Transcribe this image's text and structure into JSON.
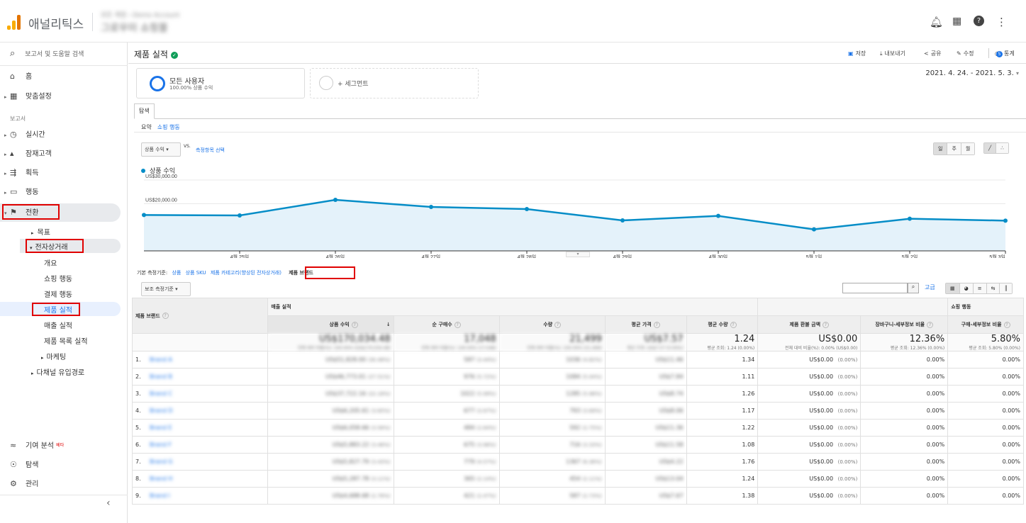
{
  "topbar": {
    "app_name": "애널리틱스",
    "account_line1": "모든 계정 › Demo Account",
    "account_line2": "그로우미 쇼핑몰",
    "bell_icon": "bell-icon",
    "apps_icon": "apps-grid-icon",
    "help_icon": "help-icon",
    "more_icon": "more-vert-icon"
  },
  "sidebar": {
    "search_label": "보고서 및 도움말 검색",
    "home": "홈",
    "custom": "맞춤설정",
    "reports_header": "보고서",
    "realtime": "실시간",
    "audience": "잠재고객",
    "acquisition": "획득",
    "behavior": "행동",
    "conversions": "전환",
    "goals": "목표",
    "ecommerce": "전자상거래",
    "overview": "개요",
    "shopping_behavior": "쇼핑 행동",
    "checkout_behavior": "결제 행동",
    "product_performance": "제품 실적",
    "sales_performance": "매출 실적",
    "product_list_performance": "제품 목록 실적",
    "marketing": "마케팅",
    "multichannel": "다채널 유입경로",
    "attribution": "기여 분석",
    "beta": "베타",
    "discover": "탐색",
    "admin": "관리",
    "collapse": "‹"
  },
  "header": {
    "title": "제품 실적",
    "save": "저장",
    "export": "내보내기",
    "share": "공유",
    "edit": "수정",
    "insights": "통계",
    "insights_count": "5"
  },
  "segments": {
    "all_users": "모든 사용자",
    "all_users_sub": "100.00% 상품 수익",
    "add_segment": "+ 세그먼트"
  },
  "date_range": "2021. 4. 24. - 2021. 5. 3.",
  "tabs": {
    "explore": "탐색",
    "summary": "요약",
    "shopping_behavior": "쇼핑 행동"
  },
  "graph_controls": {
    "metric": "상품 수익",
    "vs": "VS.",
    "select_metric": "측정항목 선택",
    "day": "일",
    "week": "주",
    "month": "월"
  },
  "chart_data": {
    "type": "line",
    "series": [
      {
        "name": "상품 수익",
        "values": [
          15200,
          15000,
          21600,
          18600,
          17700,
          12900,
          14800,
          9100,
          13600,
          12800
        ]
      }
    ],
    "x": [
      "...",
      "4월 25일",
      "4월 26일",
      "4월 27일",
      "4월 28일",
      "4월 29일",
      "4월 30일",
      "5월 1일",
      "5월 2일",
      "5월 3일"
    ],
    "yticks": [
      "US$30,000.00",
      "US$20,000.00",
      "US$10,000.00"
    ],
    "ylim": [
      0,
      30000
    ],
    "color": "#058dc7",
    "fill": "#e4f2fa"
  },
  "primary_dims": {
    "label": "기본 측정기준:",
    "items": [
      "상품",
      "상품 SKU",
      "제품 카테고리(향상된 전자상거래)"
    ],
    "selected": "제품 브랜드"
  },
  "table_controls": {
    "secondary": "보조 측정기준",
    "advanced": "고급"
  },
  "table": {
    "dim_header": "제품 브랜드",
    "group1": "매출 실적",
    "group2": "쇼핑 행동",
    "columns": [
      "상품 수익",
      "순 구매수",
      "수량",
      "평균 가격",
      "평균 수량",
      "제품 환불 금액",
      "장바구니-세부정보 비율",
      "구매-세부정보 비율"
    ],
    "sort_icon": "sort-down-icon",
    "totals": {
      "revenue": "US$170,034.48",
      "revenue_sub": "전체 대비 비율(%): 100.00% (US$170,034.48)",
      "purchases": "17,048",
      "purchases_sub": "전체 대비 비율(%): 100.00% (17,048)",
      "qty": "21,499",
      "qty_sub": "전체 대비 비율(%): 100.00% (21,499)",
      "avgprice": "US$7.57",
      "avgprice_sub": "평균 조회: US$7.57 (0.00%)",
      "avgqty": "1.24",
      "avgqty_sub": "평균 조회: 1.24 (0.00%)",
      "refund": "US$0.00",
      "refund_sub": "전체 대비 비율(%): 0.00% (US$0.00)",
      "cart": "12.36%",
      "cart_sub": "평균 조회: 12.36% (0.00%)",
      "buy": "5.80%",
      "buy_sub": "평균 조회: 5.80% (0.00%)"
    },
    "rows": [
      {
        "n": "1.",
        "brand": "Brand A",
        "rev": "US$51,828.00",
        "revp": "(30.48%)",
        "pur": "587",
        "purp": "(3.44%)",
        "qty": "1036",
        "qtyp": "(4.82%)",
        "avg": "US$11.46",
        "aq": "1.34",
        "ref": "US$0.00",
        "refp": "(0.00%)",
        "cart": "0.00%",
        "buy": "0.00%"
      },
      {
        "n": "2.",
        "brand": "Brand B",
        "rev": "US$46,773.01",
        "revp": "(27.51%)",
        "pur": "976",
        "purp": "(5.72%)",
        "qty": "1084",
        "qtyp": "(5.04%)",
        "avg": "US$7.84",
        "aq": "1.11",
        "ref": "US$0.00",
        "refp": "(0.00%)",
        "cart": "0.00%",
        "buy": "0.00%"
      },
      {
        "n": "3.",
        "brand": "Brand C",
        "rev": "US$37,722.16",
        "revp": "(22.18%)",
        "pur": "1022",
        "purp": "(5.99%)",
        "qty": "1285",
        "qtyp": "(5.98%)",
        "avg": "US$8.74",
        "aq": "1.26",
        "ref": "US$0.00",
        "refp": "(0.00%)",
        "cart": "0.00%",
        "buy": "0.00%"
      },
      {
        "n": "4.",
        "brand": "Brand D",
        "rev": "US$6,205.61",
        "revp": "(3.65%)",
        "pur": "677",
        "purp": "(3.97%)",
        "qty": "793",
        "qtyp": "(3.69%)",
        "avg": "US$8.06",
        "aq": "1.17",
        "ref": "US$0.00",
        "refp": "(0.00%)",
        "cart": "0.00%",
        "buy": "0.00%"
      },
      {
        "n": "5.",
        "brand": "Brand E",
        "rev": "US$6,058.66",
        "revp": "(3.56%)",
        "pur": "484",
        "purp": "(2.84%)",
        "qty": "592",
        "qtyp": "(2.75%)",
        "avg": "US$11.36",
        "aq": "1.22",
        "ref": "US$0.00",
        "refp": "(0.00%)",
        "cart": "0.00%",
        "buy": "0.00%"
      },
      {
        "n": "6.",
        "brand": "Brand F",
        "rev": "US$5,883.22",
        "revp": "(3.46%)",
        "pur": "675",
        "purp": "(3.96%)",
        "qty": "716",
        "qtyp": "(3.33%)",
        "avg": "US$11.58",
        "aq": "1.08",
        "ref": "US$0.00",
        "refp": "(0.00%)",
        "cart": "0.00%",
        "buy": "0.00%"
      },
      {
        "n": "7.",
        "brand": "Brand G",
        "rev": "US$5,827.79",
        "revp": "(3.43%)",
        "pur": "779",
        "purp": "(4.57%)",
        "qty": "1367",
        "qtyp": "(6.36%)",
        "avg": "US$4.22",
        "aq": "1.76",
        "ref": "US$0.00",
        "refp": "(0.00%)",
        "cart": "0.00%",
        "buy": "0.00%"
      },
      {
        "n": "8.",
        "brand": "Brand H",
        "rev": "US$5,287.78",
        "revp": "(3.11%)",
        "pur": "365",
        "purp": "(2.14%)",
        "qty": "454",
        "qtyp": "(2.11%)",
        "avg": "US$13.04",
        "aq": "1.24",
        "ref": "US$0.00",
        "refp": "(0.00%)",
        "cart": "0.00%",
        "buy": "0.00%"
      },
      {
        "n": "9.",
        "brand": "Brand I",
        "rev": "US$4,688.68",
        "revp": "(2.76%)",
        "pur": "421",
        "purp": "(2.47%)",
        "qty": "587",
        "qtyp": "(2.73%)",
        "avg": "US$7.67",
        "aq": "1.38",
        "ref": "US$0.00",
        "refp": "(0.00%)",
        "cart": "0.00%",
        "buy": "0.00%"
      }
    ]
  }
}
